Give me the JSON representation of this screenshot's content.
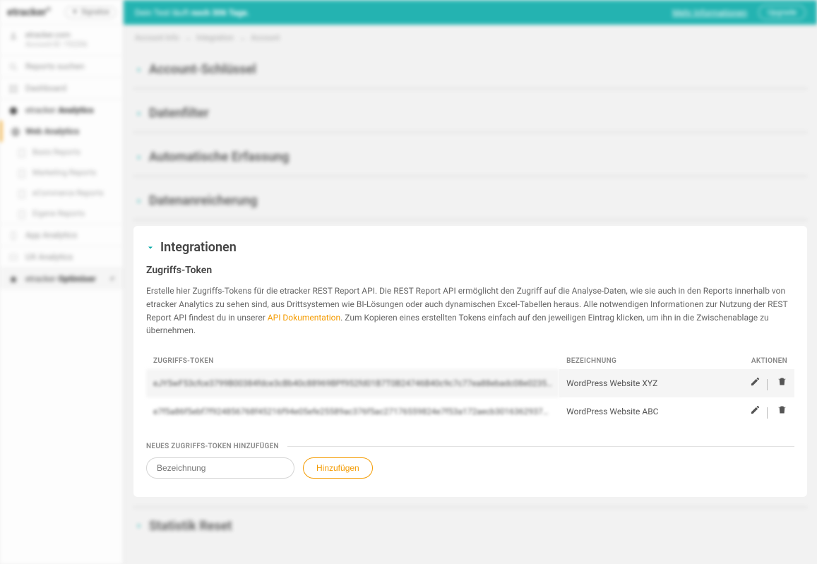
{
  "brand": {
    "logo_pre": "etracker",
    "signalize_btn": "Signalize"
  },
  "topbar": {
    "trial": "Dein Test läuft noch 306 Tage.",
    "more": "Mehr Informationen",
    "upgrade": "Upgrade"
  },
  "account": {
    "line1": "etracker.com",
    "line2": "Account-ID: 192206"
  },
  "search": {
    "placeholder": "Reports suchen"
  },
  "side": {
    "dashboard": "Dashboard",
    "analytics": "etracker Analytics",
    "web": "Web Analytics",
    "basis": "Basis Reports",
    "marketing": "Marketing Reports",
    "ecom": "eCommerce Reports",
    "eigene": "Eigene Reports",
    "app": "App Analytics",
    "ux": "UX Analytics",
    "optimiser": "etracker Optimiser"
  },
  "crumbs": {
    "a": "Account Info",
    "b": "Integration",
    "c": "Account"
  },
  "secs": {
    "key": "Account-Schlüssel",
    "filter": "Datenfilter",
    "auto": "Automatische Erfassung",
    "enrich": "Datenanreicherung",
    "integr": "Integrationen",
    "reset": "Statistik Reset"
  },
  "panel": {
    "sub": "Zugriffs-Token",
    "desc1": "Erstelle hier Zugriffs-Tokens für die etracker REST Report API. Die REST Report API ermöglicht den Zugriff auf die Analyse-Daten, wie sie auch in den Reports innerhalb von etracker Analytics zu sehen sind, aus Drittsystemen wie BI-Lösungen oder auch dynamischen Excel-Tabellen heraus. Alle notwendigen Informationen zur Nutzung der REST Report API findest du in unserer ",
    "desc_link": "API Dokumentation",
    "desc2": ". Zum Kopieren eines erstellten Tokens einfach auf den jeweiligen Eintrag klicken, um ihn in die Zwischenablage zu übernehmen.",
    "th_token": "ZUGRIFFS-TOKEN",
    "th_label": "BEZEICHNUNG",
    "th_actions": "AKTIONEN",
    "rows": [
      {
        "token": "eJY5wF53cfce3799B00384fdce3cBb40c88969BPf952fd01B7T0B24746B40c9c7c77ea88ebadc08e0235…",
        "label": "WordPress Website XYZ"
      },
      {
        "token": "e7f5a86f5ebf7f924856768f45216f94e05efe25589ac376f5ac27176559824e7f53a172aecb3016362937…",
        "label": "WordPress Website ABC"
      }
    ],
    "add_legend": "NEUES ZUGRIFFS-TOKEN HINZUFÜGEN",
    "add_placeholder": "Bezeichnung",
    "add_btn": "Hinzufügen"
  }
}
